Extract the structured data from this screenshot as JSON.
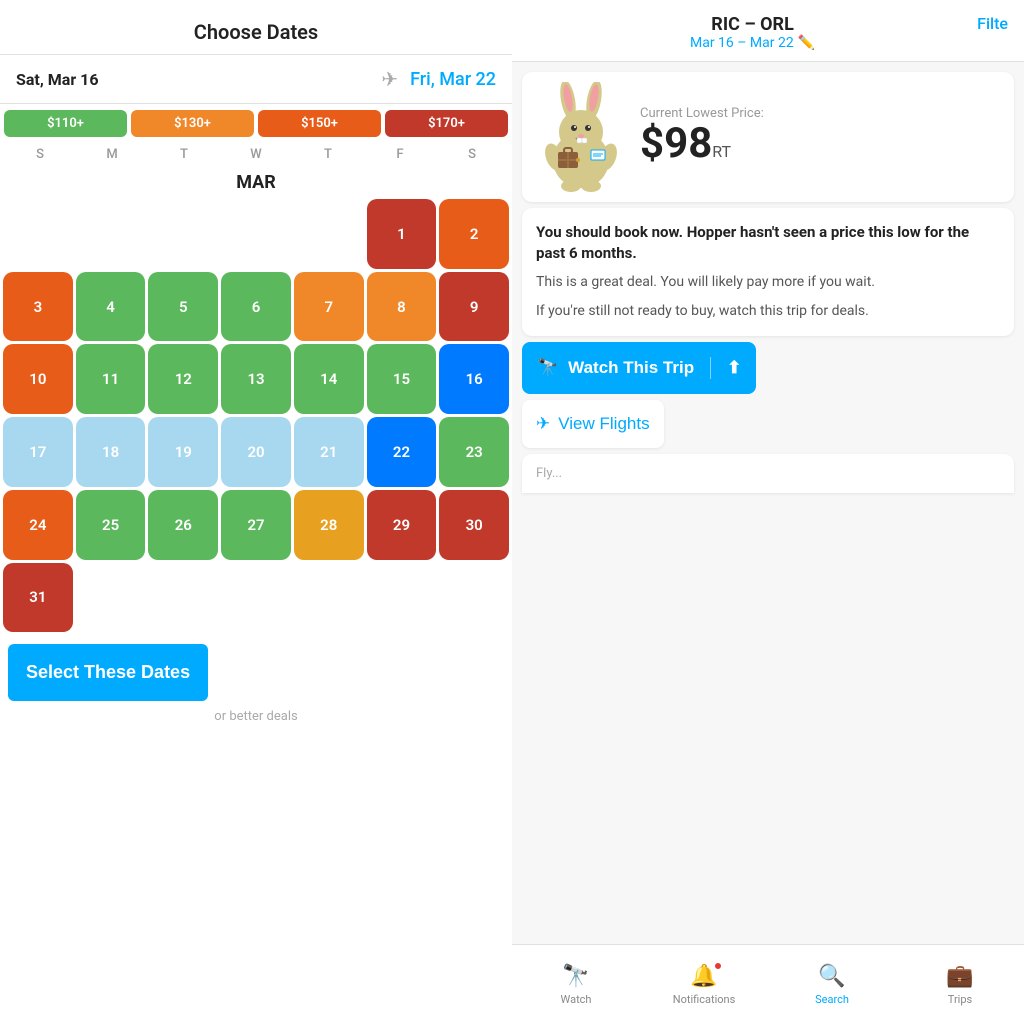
{
  "left": {
    "header": "Choose Dates",
    "depart_date": "Sat, Mar 16",
    "return_date": "Fri, Mar 22",
    "price_legend": [
      {
        "label": "$110+",
        "color": "chip-green"
      },
      {
        "label": "$130+",
        "color": "chip-orange"
      },
      {
        "label": "$150+",
        "color": "chip-dark-orange"
      },
      {
        "label": "$170+",
        "color": "chip-red"
      }
    ],
    "days_header": [
      "S",
      "M",
      "T",
      "W",
      "T",
      "F",
      "S"
    ],
    "month_label": "MAR",
    "select_btn": "Select These Dates",
    "or_better": "or better deals"
  },
  "right": {
    "route": "RIC – ORL",
    "dates": "Mar 16 – Mar 22",
    "filter_label": "Filte",
    "current_lowest_label": "Current Lowest Price:",
    "price": "$98",
    "price_suffix": "RT",
    "advice_title": "You should book now. Hopper hasn't seen a price this low for the past 6 months.",
    "advice_body1": "This is a great deal. You will likely pay more if you wait.",
    "advice_body2": "If you're still not ready to buy, watch this trip for deals.",
    "watch_btn": "Watch This Trip",
    "view_flights": "View Flights",
    "bottom_nav": [
      {
        "label": "Watch",
        "icon": "🔭",
        "active": false
      },
      {
        "label": "Notifications",
        "icon": "🔔",
        "active": false,
        "badge": true
      },
      {
        "label": "Search",
        "icon": "🔍",
        "active": true
      },
      {
        "label": "Trips",
        "icon": "💼",
        "active": false
      }
    ]
  }
}
